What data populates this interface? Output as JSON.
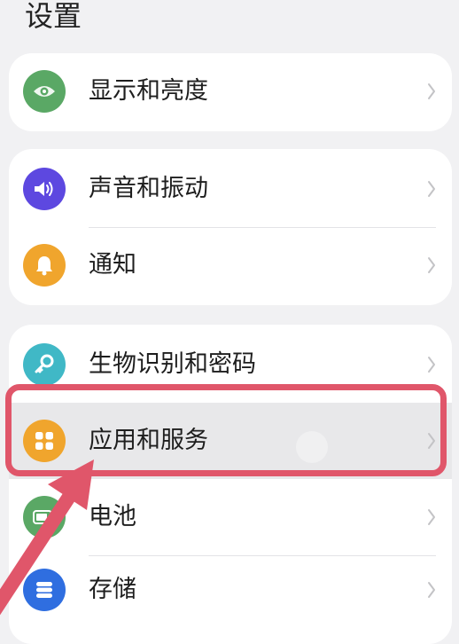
{
  "page": {
    "title": "设置"
  },
  "colors": {
    "display": "#5aa865",
    "sound": "#5d48e0",
    "notify": "#f0a52d",
    "biometric": "#40b8c6",
    "apps": "#f0a52d",
    "battery": "#5aa865",
    "storage": "#2f6ee0",
    "highlight": "#e0566a"
  },
  "groups": [
    {
      "items": [
        {
          "label": "显示和亮度",
          "icon": "eye-icon"
        }
      ]
    },
    {
      "items": [
        {
          "label": "声音和振动",
          "icon": "speaker-icon"
        },
        {
          "label": "通知",
          "icon": "bell-icon"
        }
      ]
    },
    {
      "items": [
        {
          "label": "生物识别和密码",
          "icon": "key-icon"
        },
        {
          "label": "应用和服务",
          "icon": "apps-grid-icon",
          "highlighted": true
        },
        {
          "label": "电池",
          "icon": "battery-icon"
        },
        {
          "label": "存储",
          "icon": "storage-icon"
        }
      ]
    }
  ]
}
